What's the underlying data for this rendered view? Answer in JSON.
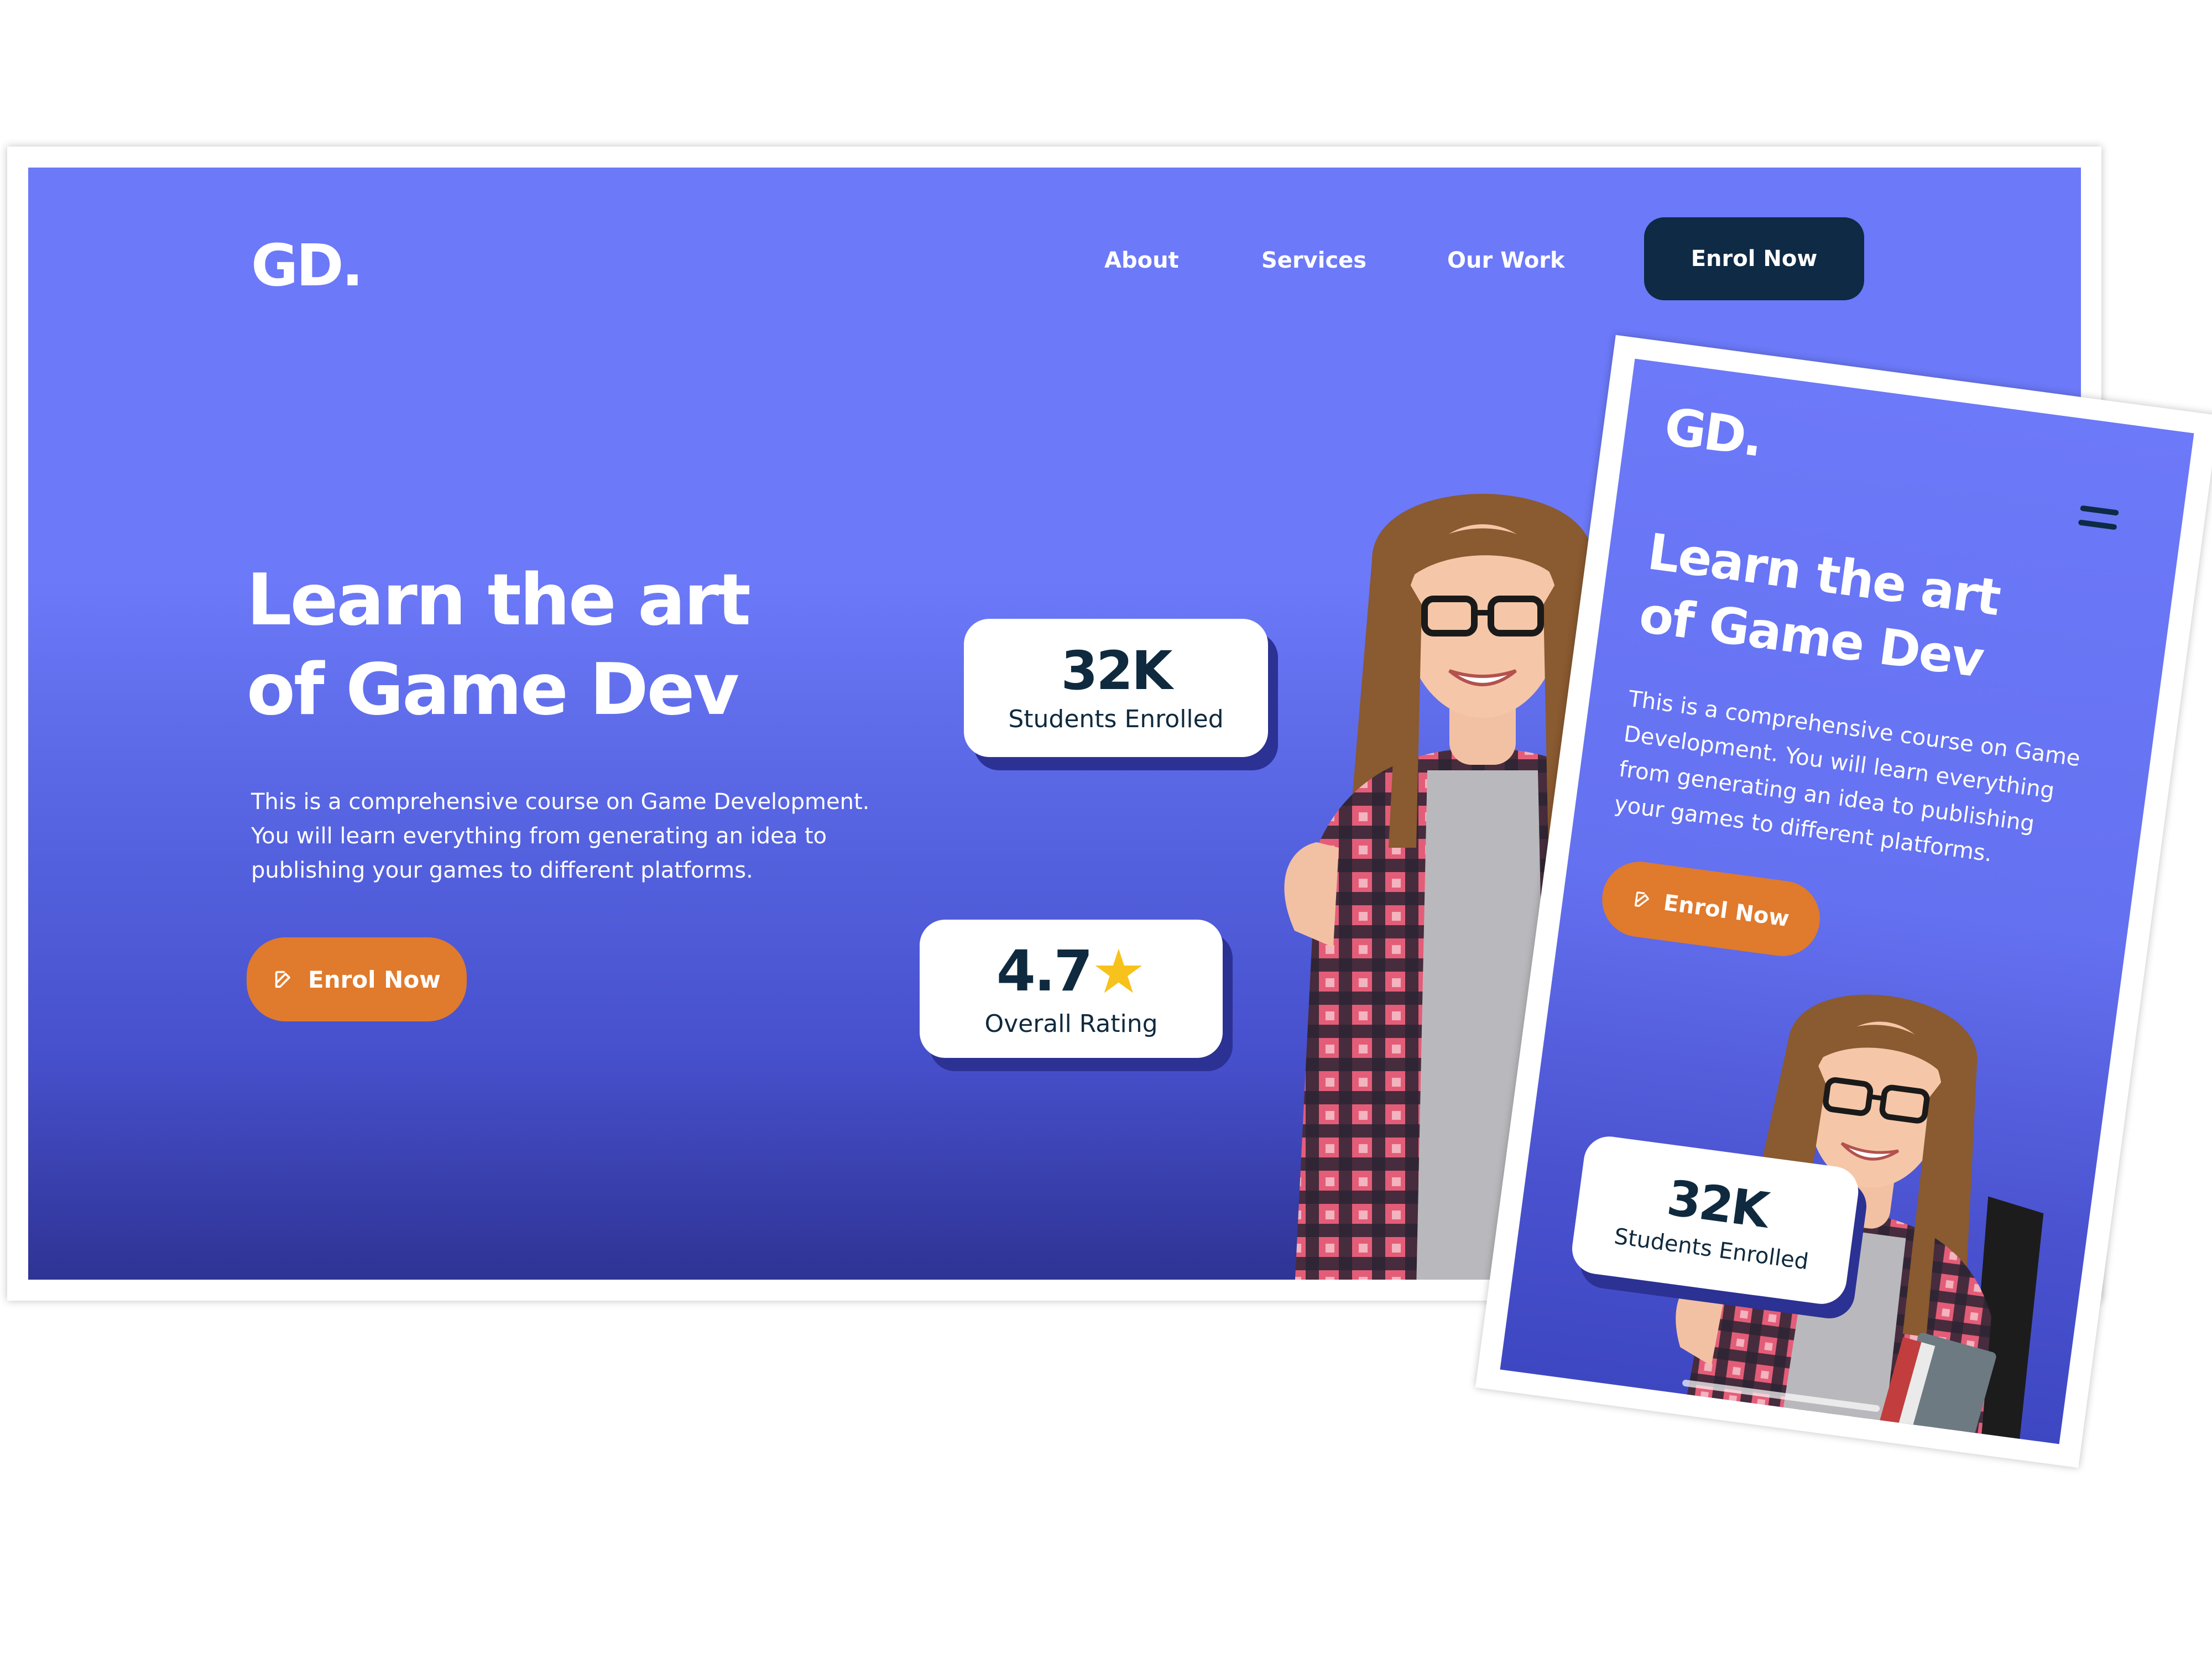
{
  "desktop": {
    "logo": "GD.",
    "nav": {
      "links": [
        "About",
        "Services",
        "Our Work"
      ],
      "cta": "Enrol Now"
    },
    "hero": {
      "title_line1": "Learn the art",
      "title_line2": "of Game Dev",
      "desc_line1": "This is a comprehensive course on Game Development.",
      "desc_line2": "You will learn everything from generating an idea to",
      "desc_line3": "publishing your games to different platforms.",
      "cta": "Enrol Now",
      "cta_icon": "edit-icon"
    },
    "stats": {
      "students_value": "32K",
      "students_label": "Students Enrolled",
      "rating_value": "4.7",
      "rating_icon": "star-icon",
      "rating_label": "Overall Rating"
    }
  },
  "mobile": {
    "logo": "GD.",
    "menu_icon": "hamburger-menu-icon",
    "hero": {
      "title_line1": "Learn the art",
      "title_line2": "of Game Dev",
      "desc_line1": "This is a comprehensive course on Game",
      "desc_line2": "Development. You will learn everything",
      "desc_line3": "from generating an idea to publishing",
      "desc_line4": "your games to different platforms.",
      "cta": "Enrol Now",
      "cta_icon": "edit-icon"
    },
    "stats": {
      "students_value": "32K",
      "students_label": "Students Enrolled"
    }
  },
  "colors": {
    "hero_bg": "#6c79f8",
    "hero_bg_bottom": "#2e3394",
    "accent_orange": "#e07a2c",
    "dark_navy": "#0e2a45",
    "star_yellow": "#f7c21b",
    "card_shadow": "#2c3194"
  }
}
